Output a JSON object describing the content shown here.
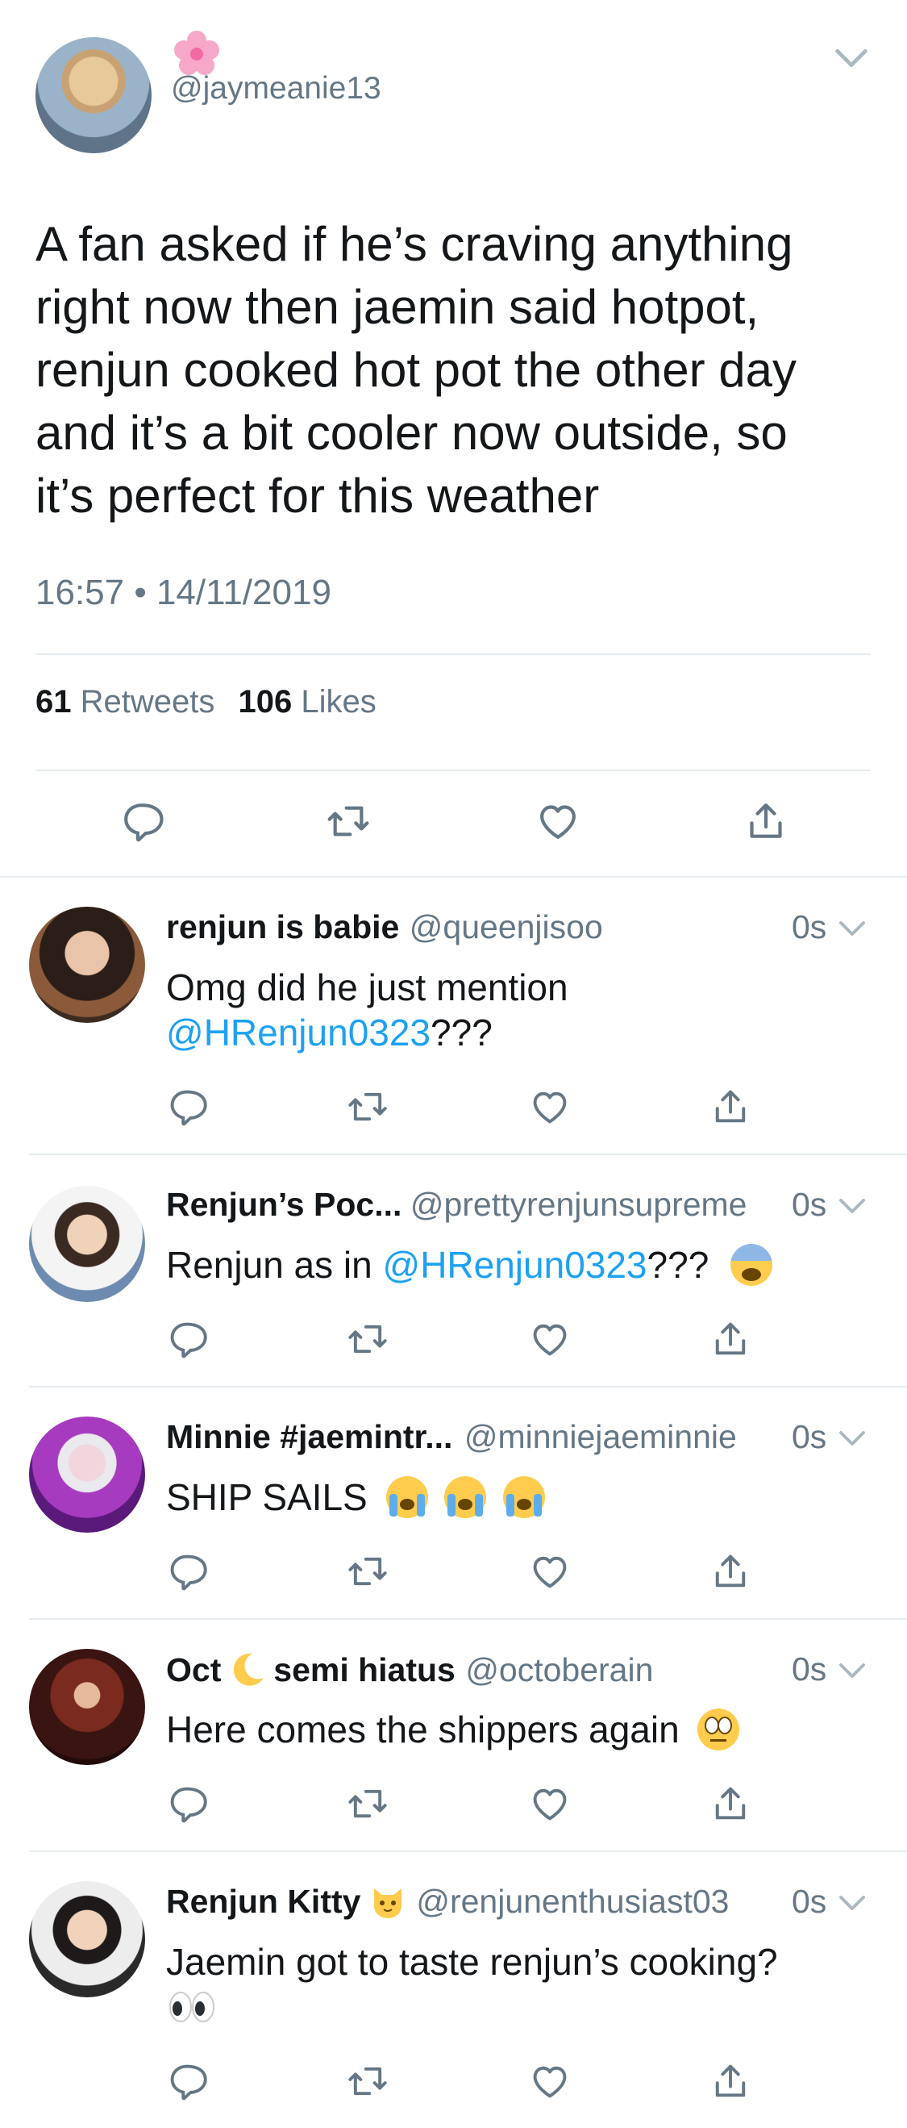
{
  "tweet": {
    "handle": "@jaymeanie13",
    "text": "A fan asked if he’s craving anything right now then jaemin said hotpot, renjun cooked hot pot the other day and it’s a bit cooler now outside, so it’s perfect for this weather",
    "timestamp": "16:57 • 14/11/2019",
    "retweets_count": "61",
    "retweets_label": "Retweets",
    "likes_count": "106",
    "likes_label": "Likes"
  },
  "replies": [
    {
      "name": "renjun is babie",
      "handle": "@queenjisoo",
      "time": "0s",
      "text_before": "Omg did he just mention",
      "mention": "@HRenjun0323",
      "text_after": "???"
    },
    {
      "name": "Renjun’s Poc...",
      "handle": "@prettyrenjunsupreme",
      "time": "0s",
      "text_before": "Renjun as in ",
      "mention": "@HRenjun0323",
      "text_after": "???"
    },
    {
      "name": "Minnie #jaemintr...",
      "handle": "@minniejaeminnie",
      "time": "0s",
      "text_before": "SHIP SAILS"
    },
    {
      "name_part1": "Oct",
      "name_part2": "semi hiatus",
      "handle": "@octoberain",
      "time": "0s",
      "text_before": "Here comes the shippers again"
    },
    {
      "name": "Renjun Kitty",
      "handle": "@renjunenthusiast03",
      "time": "0s",
      "text_before": "Jaemin got to taste renjun’s cooking?"
    }
  ],
  "colors": {
    "mention": "#1da1f2",
    "muted": "#657786",
    "divider": "#e6ecf0"
  },
  "icons": [
    "flower-emoji",
    "chevron-down-icon",
    "reply-icon",
    "retweet-icon",
    "like-icon",
    "share-icon",
    "fearful-face-emoji",
    "crying-face-emoji",
    "moon-emoji",
    "eye-roll-emoji",
    "cat-emoji",
    "eyes-emoji"
  ]
}
